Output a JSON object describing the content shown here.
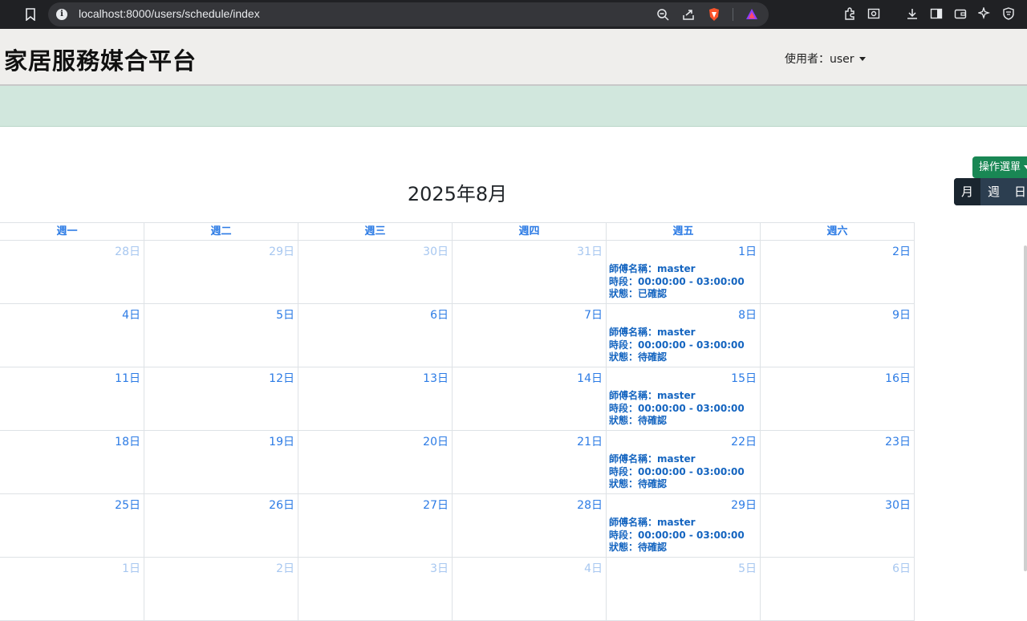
{
  "browser": {
    "url": "localhost:8000/users/schedule/index"
  },
  "header": {
    "brand": "家居服務媒合平台",
    "user_label": "使用者：user"
  },
  "toolbar": {
    "ops_label": "操作選單",
    "views": [
      "月",
      "週",
      "日"
    ]
  },
  "calendar": {
    "title": "2025年8月",
    "weekdays": [
      "週一",
      "週二",
      "週三",
      "週四",
      "週五",
      "週六"
    ],
    "rows": [
      [
        {
          "d": "28日",
          "o": true
        },
        {
          "d": "29日",
          "o": true
        },
        {
          "d": "30日",
          "o": true
        },
        {
          "d": "31日",
          "o": true
        },
        {
          "d": "1日",
          "e": [
            "師傅名稱：master",
            "時段：00:00:00 - 03:00:00",
            "狀態：已確認"
          ]
        },
        {
          "d": "2日"
        }
      ],
      [
        {
          "d": "4日"
        },
        {
          "d": "5日"
        },
        {
          "d": "6日"
        },
        {
          "d": "7日"
        },
        {
          "d": "8日",
          "e": [
            "師傅名稱：master",
            "時段：00:00:00 - 03:00:00",
            "狀態：待確認"
          ]
        },
        {
          "d": "9日"
        }
      ],
      [
        {
          "d": "11日"
        },
        {
          "d": "12日"
        },
        {
          "d": "13日"
        },
        {
          "d": "14日"
        },
        {
          "d": "15日",
          "e": [
            "師傅名稱：master",
            "時段：00:00:00 - 03:00:00",
            "狀態：待確認"
          ]
        },
        {
          "d": "16日"
        }
      ],
      [
        {
          "d": "18日"
        },
        {
          "d": "19日"
        },
        {
          "d": "20日"
        },
        {
          "d": "21日"
        },
        {
          "d": "22日",
          "e": [
            "師傅名稱：master",
            "時段：00:00:00 - 03:00:00",
            "狀態：待確認"
          ]
        },
        {
          "d": "23日"
        }
      ],
      [
        {
          "d": "25日"
        },
        {
          "d": "26日"
        },
        {
          "d": "27日"
        },
        {
          "d": "28日"
        },
        {
          "d": "29日",
          "e": [
            "師傅名稱：master",
            "時段：00:00:00 - 03:00:00",
            "狀態：待確認"
          ]
        },
        {
          "d": "30日"
        }
      ],
      [
        {
          "d": "1日",
          "o": true
        },
        {
          "d": "2日",
          "o": true
        },
        {
          "d": "3日",
          "o": true
        },
        {
          "d": "4日",
          "o": true
        },
        {
          "d": "5日",
          "o": true
        },
        {
          "d": "6日",
          "o": true
        }
      ]
    ]
  }
}
